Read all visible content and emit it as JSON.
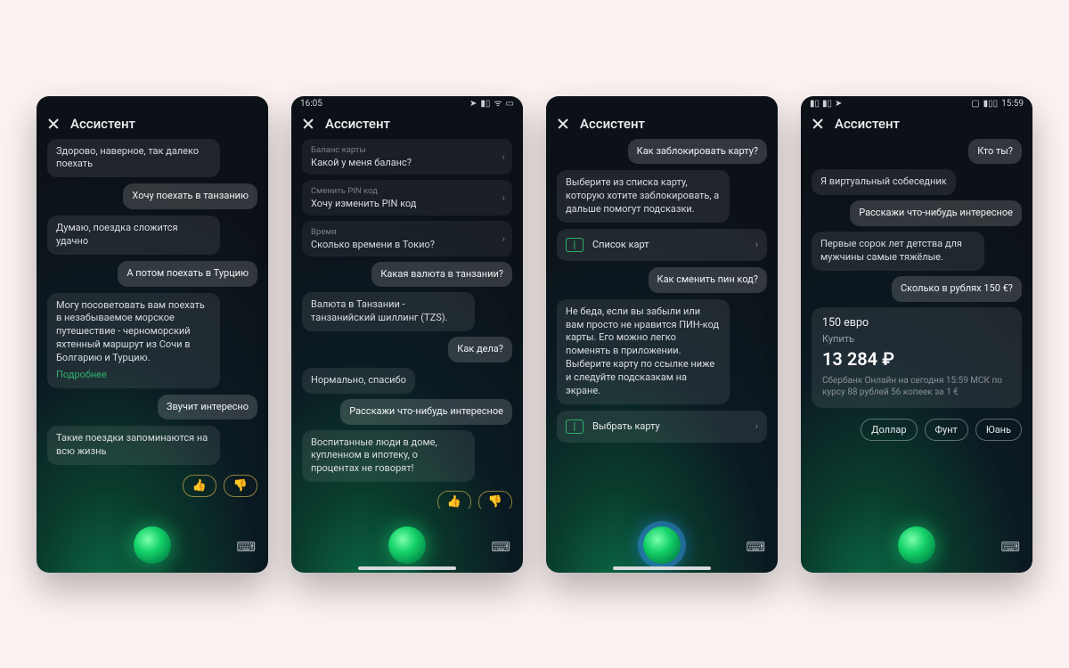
{
  "app_title": "Ассистент",
  "details_link": "Подробнее",
  "screens": [
    {
      "statusbar": null,
      "messages": [
        {
          "role": "assistant",
          "text": "Здорово, наверное, так далеко поехать"
        },
        {
          "role": "user",
          "text": "Хочу поехать в танзанию"
        },
        {
          "role": "assistant",
          "text": "Думаю, поездка сложится удачно"
        },
        {
          "role": "user",
          "text": "А потом поехать в Турцию"
        },
        {
          "role": "assistant",
          "text": "Могу посоветовать вам поехать в незабываемое морское путешествие - черноморский яхтенный маршрут из Сочи в Болгарию и Турцию.",
          "link": "Подробнее"
        },
        {
          "role": "user",
          "text": "Звучит интересно"
        },
        {
          "role": "assistant",
          "text": "Такие поездки запоминаются на всю жизнь"
        }
      ],
      "feedback": {
        "up": "👍",
        "down": "👎"
      },
      "orb": "green"
    },
    {
      "statusbar": {
        "time": "16:05",
        "icons": [
          "location",
          "signal",
          "wifi",
          "battery"
        ]
      },
      "suggestions": [
        {
          "caption": "Баланс карты",
          "text": "Какой у меня баланс?"
        },
        {
          "caption": "Сменить PIN код",
          "text": "Хочу изменить PIN код"
        },
        {
          "caption": "Время",
          "text": "Сколько времени в Токио?"
        }
      ],
      "messages": [
        {
          "role": "user",
          "text": "Какая валюта в танзании?"
        },
        {
          "role": "assistant",
          "text": "Валюта в Танзании - танзанийский шиллинг (TZS)."
        },
        {
          "role": "user",
          "text": "Как дела?"
        },
        {
          "role": "assistant",
          "text": "Нормально, спасибо"
        },
        {
          "role": "user",
          "text": "Расскажи что-нибудь интересное"
        },
        {
          "role": "assistant",
          "text": "Воспитанные люди в доме, купленном в ипотеку, о процентах не говорят!"
        }
      ],
      "feedback": {
        "up": "👍",
        "down": "👎"
      },
      "orb": "green",
      "homebar": true
    },
    {
      "statusbar": null,
      "messages": [
        {
          "role": "user",
          "text": "Как заблокировать карту?"
        },
        {
          "role": "assistant",
          "text": "Выберите из списка карту, которую хотите заблокировать, а дальше помогут подсказки."
        },
        {
          "role": "action",
          "text": "Список карт"
        },
        {
          "role": "user",
          "text": "Как сменить пин код?"
        },
        {
          "role": "assistant",
          "text": "Не беда, если вы забыли или вам просто не нравится ПИН-код карты. Его можно легко поменять в приложении. Выберите карту по ссылке ниже и следуйте подсказкам на экране."
        },
        {
          "role": "action",
          "text": "Выбрать карту"
        }
      ],
      "orb": "blue",
      "homebar": true
    },
    {
      "statusbar": {
        "time": "15:59",
        "icons": [
          "signal",
          "signal",
          "send",
          "vibrate",
          "battery-80"
        ],
        "time_right": true
      },
      "messages": [
        {
          "role": "user",
          "text": "Кто ты?"
        },
        {
          "role": "assistant",
          "text": "Я виртуальный собеседник"
        },
        {
          "role": "user",
          "text": "Расскажи что-нибудь интересное"
        },
        {
          "role": "assistant",
          "text": "Первые сорок лет детства для мужчины самые тяжёлые."
        },
        {
          "role": "user",
          "text": "Сколько в рублях 150 €?"
        }
      ],
      "card": {
        "title": "150 евро",
        "sub": "Купить",
        "big": "13 284 ₽",
        "note": "Сбербанк Онлайн на сегодня 15:59 МСК по курсу 88 рублей 56 копеек за 1 €"
      },
      "chips": [
        "Доллар",
        "Фунт",
        "Юань"
      ],
      "orb": "green"
    }
  ]
}
